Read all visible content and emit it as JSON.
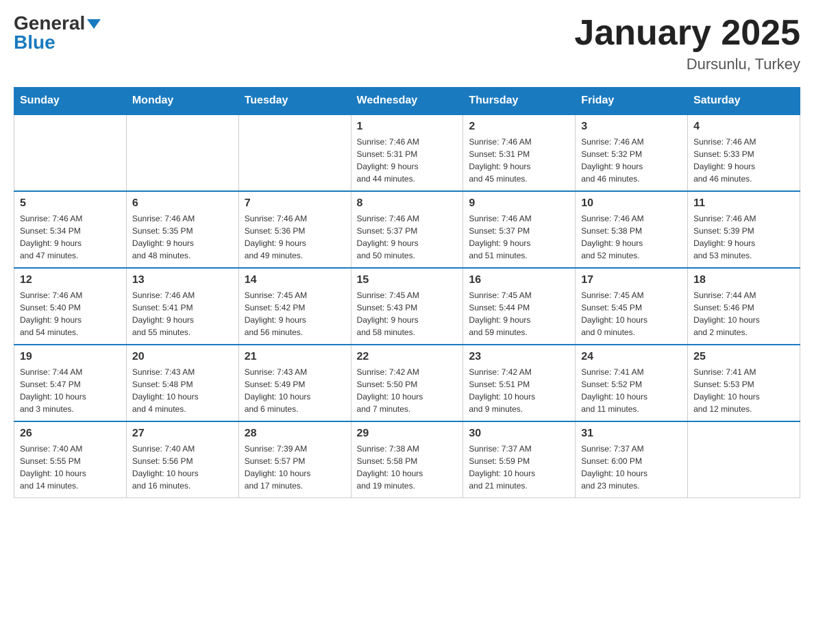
{
  "header": {
    "logo_general": "General",
    "logo_blue": "Blue",
    "title": "January 2025",
    "subtitle": "Dursunlu, Turkey"
  },
  "days_of_week": [
    "Sunday",
    "Monday",
    "Tuesday",
    "Wednesday",
    "Thursday",
    "Friday",
    "Saturday"
  ],
  "weeks": [
    [
      {
        "num": "",
        "info": ""
      },
      {
        "num": "",
        "info": ""
      },
      {
        "num": "",
        "info": ""
      },
      {
        "num": "1",
        "info": "Sunrise: 7:46 AM\nSunset: 5:31 PM\nDaylight: 9 hours\nand 44 minutes."
      },
      {
        "num": "2",
        "info": "Sunrise: 7:46 AM\nSunset: 5:31 PM\nDaylight: 9 hours\nand 45 minutes."
      },
      {
        "num": "3",
        "info": "Sunrise: 7:46 AM\nSunset: 5:32 PM\nDaylight: 9 hours\nand 46 minutes."
      },
      {
        "num": "4",
        "info": "Sunrise: 7:46 AM\nSunset: 5:33 PM\nDaylight: 9 hours\nand 46 minutes."
      }
    ],
    [
      {
        "num": "5",
        "info": "Sunrise: 7:46 AM\nSunset: 5:34 PM\nDaylight: 9 hours\nand 47 minutes."
      },
      {
        "num": "6",
        "info": "Sunrise: 7:46 AM\nSunset: 5:35 PM\nDaylight: 9 hours\nand 48 minutes."
      },
      {
        "num": "7",
        "info": "Sunrise: 7:46 AM\nSunset: 5:36 PM\nDaylight: 9 hours\nand 49 minutes."
      },
      {
        "num": "8",
        "info": "Sunrise: 7:46 AM\nSunset: 5:37 PM\nDaylight: 9 hours\nand 50 minutes."
      },
      {
        "num": "9",
        "info": "Sunrise: 7:46 AM\nSunset: 5:37 PM\nDaylight: 9 hours\nand 51 minutes."
      },
      {
        "num": "10",
        "info": "Sunrise: 7:46 AM\nSunset: 5:38 PM\nDaylight: 9 hours\nand 52 minutes."
      },
      {
        "num": "11",
        "info": "Sunrise: 7:46 AM\nSunset: 5:39 PM\nDaylight: 9 hours\nand 53 minutes."
      }
    ],
    [
      {
        "num": "12",
        "info": "Sunrise: 7:46 AM\nSunset: 5:40 PM\nDaylight: 9 hours\nand 54 minutes."
      },
      {
        "num": "13",
        "info": "Sunrise: 7:46 AM\nSunset: 5:41 PM\nDaylight: 9 hours\nand 55 minutes."
      },
      {
        "num": "14",
        "info": "Sunrise: 7:45 AM\nSunset: 5:42 PM\nDaylight: 9 hours\nand 56 minutes."
      },
      {
        "num": "15",
        "info": "Sunrise: 7:45 AM\nSunset: 5:43 PM\nDaylight: 9 hours\nand 58 minutes."
      },
      {
        "num": "16",
        "info": "Sunrise: 7:45 AM\nSunset: 5:44 PM\nDaylight: 9 hours\nand 59 minutes."
      },
      {
        "num": "17",
        "info": "Sunrise: 7:45 AM\nSunset: 5:45 PM\nDaylight: 10 hours\nand 0 minutes."
      },
      {
        "num": "18",
        "info": "Sunrise: 7:44 AM\nSunset: 5:46 PM\nDaylight: 10 hours\nand 2 minutes."
      }
    ],
    [
      {
        "num": "19",
        "info": "Sunrise: 7:44 AM\nSunset: 5:47 PM\nDaylight: 10 hours\nand 3 minutes."
      },
      {
        "num": "20",
        "info": "Sunrise: 7:43 AM\nSunset: 5:48 PM\nDaylight: 10 hours\nand 4 minutes."
      },
      {
        "num": "21",
        "info": "Sunrise: 7:43 AM\nSunset: 5:49 PM\nDaylight: 10 hours\nand 6 minutes."
      },
      {
        "num": "22",
        "info": "Sunrise: 7:42 AM\nSunset: 5:50 PM\nDaylight: 10 hours\nand 7 minutes."
      },
      {
        "num": "23",
        "info": "Sunrise: 7:42 AM\nSunset: 5:51 PM\nDaylight: 10 hours\nand 9 minutes."
      },
      {
        "num": "24",
        "info": "Sunrise: 7:41 AM\nSunset: 5:52 PM\nDaylight: 10 hours\nand 11 minutes."
      },
      {
        "num": "25",
        "info": "Sunrise: 7:41 AM\nSunset: 5:53 PM\nDaylight: 10 hours\nand 12 minutes."
      }
    ],
    [
      {
        "num": "26",
        "info": "Sunrise: 7:40 AM\nSunset: 5:55 PM\nDaylight: 10 hours\nand 14 minutes."
      },
      {
        "num": "27",
        "info": "Sunrise: 7:40 AM\nSunset: 5:56 PM\nDaylight: 10 hours\nand 16 minutes."
      },
      {
        "num": "28",
        "info": "Sunrise: 7:39 AM\nSunset: 5:57 PM\nDaylight: 10 hours\nand 17 minutes."
      },
      {
        "num": "29",
        "info": "Sunrise: 7:38 AM\nSunset: 5:58 PM\nDaylight: 10 hours\nand 19 minutes."
      },
      {
        "num": "30",
        "info": "Sunrise: 7:37 AM\nSunset: 5:59 PM\nDaylight: 10 hours\nand 21 minutes."
      },
      {
        "num": "31",
        "info": "Sunrise: 7:37 AM\nSunset: 6:00 PM\nDaylight: 10 hours\nand 23 minutes."
      },
      {
        "num": "",
        "info": ""
      }
    ]
  ]
}
